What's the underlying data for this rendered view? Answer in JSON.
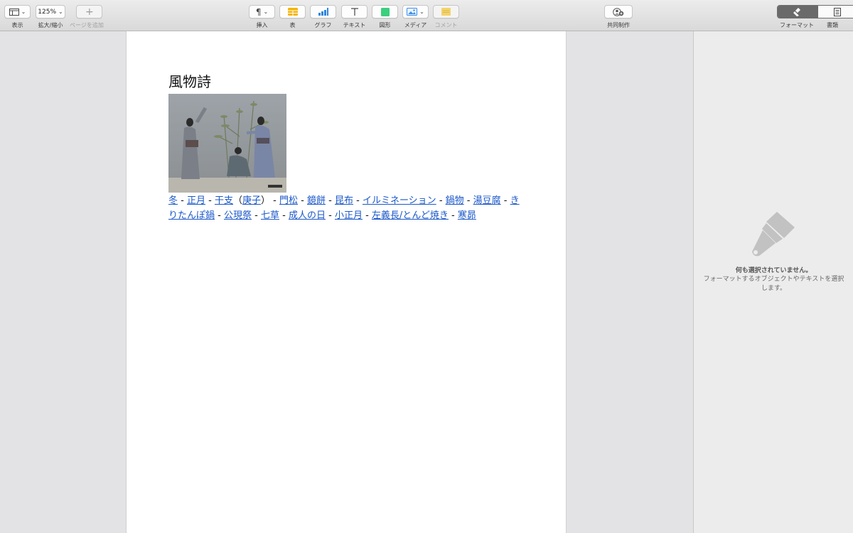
{
  "toolbar": {
    "view_label": "表示",
    "zoom_value": "125%",
    "zoom_label": "拡大/縮小",
    "add_page_label": "ページを追加",
    "insert_label": "挿入",
    "table_label": "表",
    "chart_label": "グラフ",
    "text_label": "テキスト",
    "shape_label": "図形",
    "media_label": "メディア",
    "comment_label": "コメント",
    "collaborate_label": "共同制作",
    "format_label": "フォーマット",
    "document_label": "書類"
  },
  "colors": {
    "table_icon": "#f5b400",
    "chart_icon": "#2e86de",
    "shape_icon": "#3ccf7e",
    "media_icon": "#3b8ee8",
    "comment_icon": "#f3d36b",
    "link": "#1a57c9"
  },
  "document": {
    "title": "風物詩",
    "photo_icon": "photo-of-kimono-dancers-icon",
    "links_line": [
      {
        "text": "冬",
        "link": true
      },
      {
        "text": " - ",
        "link": false
      },
      {
        "text": "正月",
        "link": true
      },
      {
        "text": " - ",
        "link": false
      },
      {
        "text": "干支",
        "link": true
      },
      {
        "text": "（",
        "link": false
      },
      {
        "text": "庚子",
        "link": true
      },
      {
        "text": "） - ",
        "link": false
      },
      {
        "text": "門松",
        "link": true
      },
      {
        "text": " - ",
        "link": false
      },
      {
        "text": "鏡餅",
        "link": true
      },
      {
        "text": " - ",
        "link": false
      },
      {
        "text": "昆布",
        "link": true
      },
      {
        "text": " - ",
        "link": false
      },
      {
        "text": "イルミネーション",
        "link": true
      },
      {
        "text": " - ",
        "link": false
      },
      {
        "text": "鍋物",
        "link": true
      },
      {
        "text": " - ",
        "link": false
      },
      {
        "text": "湯豆腐",
        "link": true
      },
      {
        "text": " - ",
        "link": false
      },
      {
        "text": "きりたんぽ鍋",
        "link": true
      },
      {
        "text": " - ",
        "link": false
      },
      {
        "text": "公現祭",
        "link": true
      },
      {
        "text": " - ",
        "link": false
      },
      {
        "text": "七草",
        "link": true
      },
      {
        "text": " - ",
        "link": false
      },
      {
        "text": "成人の日",
        "link": true
      },
      {
        "text": " - ",
        "link": false
      },
      {
        "text": "小正月",
        "link": true
      },
      {
        "text": " - ",
        "link": false
      },
      {
        "text": "左義長/とんど焼き",
        "link": true
      },
      {
        "text": " - ",
        "link": false
      },
      {
        "text": "寒昴",
        "link": true
      }
    ]
  },
  "panel": {
    "icon": "paintbrush-icon",
    "heading": "何も選択されていません。",
    "sub": "フォーマットするオブジェクトやテキストを選択します。"
  }
}
